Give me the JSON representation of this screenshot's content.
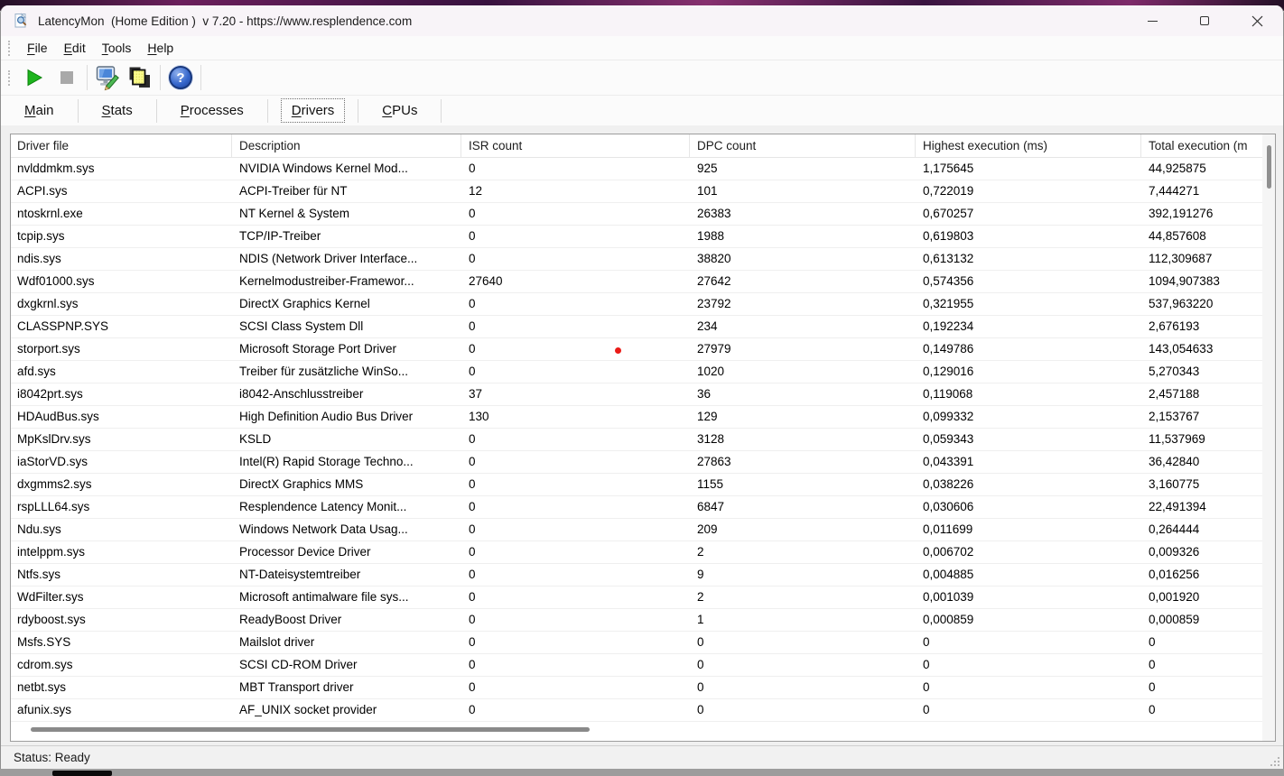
{
  "window": {
    "title": "LatencyMon  (Home Edition )  v 7.20 - https://www.resplendence.com",
    "controls": [
      "minimize",
      "maximize",
      "close"
    ]
  },
  "menu": {
    "items": [
      {
        "label": "File"
      },
      {
        "label": "Edit"
      },
      {
        "label": "Tools"
      },
      {
        "label": "Help"
      }
    ]
  },
  "toolbar": {
    "buttons": [
      "start-monitor",
      "stop-monitor",
      "trace-analysis",
      "copy-report",
      "help"
    ],
    "help_glyph": "?"
  },
  "tabs": {
    "items": [
      {
        "label": "Main",
        "active": false
      },
      {
        "label": "Stats",
        "active": false
      },
      {
        "label": "Processes",
        "active": false
      },
      {
        "label": "Drivers",
        "active": true
      },
      {
        "label": "CPUs",
        "active": false
      }
    ]
  },
  "table": {
    "columns": [
      "Driver file",
      "Description",
      "ISR count",
      "DPC count",
      "Highest execution (ms)",
      "Total execution (m"
    ],
    "rows": [
      [
        "nvlddmkm.sys",
        "NVIDIA Windows Kernel Mod...",
        "0",
        "925",
        "1,175645",
        "44,925875"
      ],
      [
        "ACPI.sys",
        "ACPI-Treiber für NT",
        "12",
        "101",
        "0,722019",
        "7,444271"
      ],
      [
        "ntoskrnl.exe",
        "NT Kernel & System",
        "0",
        "26383",
        "0,670257",
        "392,191276"
      ],
      [
        "tcpip.sys",
        "TCP/IP-Treiber",
        "0",
        "1988",
        "0,619803",
        "44,857608"
      ],
      [
        "ndis.sys",
        "NDIS (Network Driver Interface...",
        "0",
        "38820",
        "0,613132",
        "112,309687"
      ],
      [
        "Wdf01000.sys",
        "Kernelmodustreiber-Framewor...",
        "27640",
        "27642",
        "0,574356",
        "1094,907383"
      ],
      [
        "dxgkrnl.sys",
        "DirectX Graphics Kernel",
        "0",
        "23792",
        "0,321955",
        "537,963220"
      ],
      [
        "CLASSPNP.SYS",
        "SCSI Class System Dll",
        "0",
        "234",
        "0,192234",
        "2,676193"
      ],
      [
        "storport.sys",
        "Microsoft Storage Port Driver",
        "0",
        "27979",
        "0,149786",
        "143,054633"
      ],
      [
        "afd.sys",
        "Treiber für zusätzliche WinSo...",
        "0",
        "1020",
        "0,129016",
        "5,270343"
      ],
      [
        "i8042prt.sys",
        "i8042-Anschlusstreiber",
        "37",
        "36",
        "0,119068",
        "2,457188"
      ],
      [
        "HDAudBus.sys",
        "High Definition Audio Bus Driver",
        "130",
        "129",
        "0,099332",
        "2,153767"
      ],
      [
        "MpKslDrv.sys",
        "KSLD",
        "0",
        "3128",
        "0,059343",
        "11,537969"
      ],
      [
        "iaStorVD.sys",
        "Intel(R) Rapid Storage Techno...",
        "0",
        "27863",
        "0,043391",
        "36,42840"
      ],
      [
        "dxgmms2.sys",
        "DirectX Graphics MMS",
        "0",
        "1155",
        "0,038226",
        "3,160775"
      ],
      [
        "rspLLL64.sys",
        "Resplendence Latency Monit...",
        "0",
        "6847",
        "0,030606",
        "22,491394"
      ],
      [
        "Ndu.sys",
        "Windows Network Data Usag...",
        "0",
        "209",
        "0,011699",
        "0,264444"
      ],
      [
        "intelppm.sys",
        "Processor Device Driver",
        "0",
        "2",
        "0,006702",
        "0,009326"
      ],
      [
        "Ntfs.sys",
        "NT-Dateisystemtreiber",
        "0",
        "9",
        "0,004885",
        "0,016256"
      ],
      [
        "WdFilter.sys",
        "Microsoft antimalware file sys...",
        "0",
        "2",
        "0,001039",
        "0,001920"
      ],
      [
        "rdyboost.sys",
        "ReadyBoost Driver",
        "0",
        "1",
        "0,000859",
        "0,000859"
      ],
      [
        "Msfs.SYS",
        "Mailslot driver",
        "0",
        "0",
        "0",
        "0"
      ],
      [
        "cdrom.sys",
        "SCSI CD-ROM Driver",
        "0",
        "0",
        "0",
        "0"
      ],
      [
        "netbt.sys",
        "MBT Transport driver",
        "0",
        "0",
        "0",
        "0"
      ],
      [
        "afunix.sys",
        "AF_UNIX socket provider",
        "0",
        "0",
        "0",
        "0"
      ]
    ]
  },
  "status": {
    "text": "Status: Ready"
  },
  "colors": {
    "titlebar_bg": "#f8f4f8",
    "play_green": "#1db41d",
    "help_blue": "#2f63c8",
    "pointer_dot_red": "#ea1b17"
  }
}
